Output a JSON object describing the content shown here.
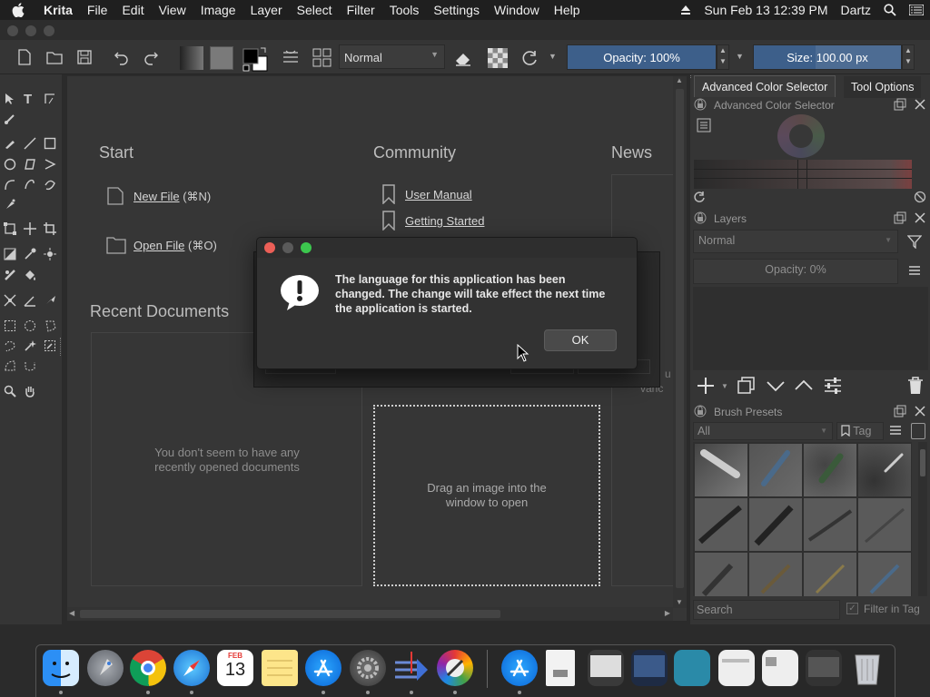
{
  "menubar": {
    "app": "Krita",
    "items": [
      "File",
      "Edit",
      "View",
      "Image",
      "Layer",
      "Select",
      "Filter",
      "Tools",
      "Settings",
      "Window",
      "Help"
    ],
    "datetime": "Sun Feb 13  12:39 PM",
    "user": "Dartz"
  },
  "toolbar": {
    "blend_mode": "Normal",
    "opacity": "Opacity: 100%",
    "size": "Size: 100.00 px"
  },
  "welcome": {
    "start_heading": "Start",
    "new_file": "New File",
    "new_file_shortcut": "(⌘N)",
    "open_file": "Open File",
    "open_file_shortcut": "(⌘O)",
    "community_heading": "Community",
    "user_manual": "User Manual",
    "getting_started": "Getting Started",
    "news_heading": "News",
    "recent_heading": "Recent Documents",
    "recent_empty": "You don't seem to have any recently opened documents",
    "drag_hint": "Drag an image into the window to open",
    "behind_text_1": "n:",
    "behind_text_2": "u c",
    "behind_text_3": "vanc"
  },
  "dialog": {
    "message": "The language for this application has been changed. The change will take effect the next time the application is started.",
    "ok_label": "OK"
  },
  "dockers": {
    "tab_color": "Advanced Color Selector",
    "tab_tool": "Tool Options",
    "color_title": "Advanced Color Selector",
    "layers_title": "Layers",
    "layers_blend": "Normal",
    "layers_opacity": "Opacity:  0%",
    "brush_title": "Brush Presets",
    "brush_filter": "All",
    "brush_tag": "Tag",
    "search_placeholder": "Search",
    "filter_in_tag": "Filter in Tag"
  },
  "dock": {
    "calendar_month": "FEB",
    "calendar_day": "13"
  },
  "colors": {
    "accent": "#3d5f8a",
    "close_red": "#ec5f57",
    "min_yellow": "#5a5a5a",
    "max_green": "#3cc74e"
  }
}
